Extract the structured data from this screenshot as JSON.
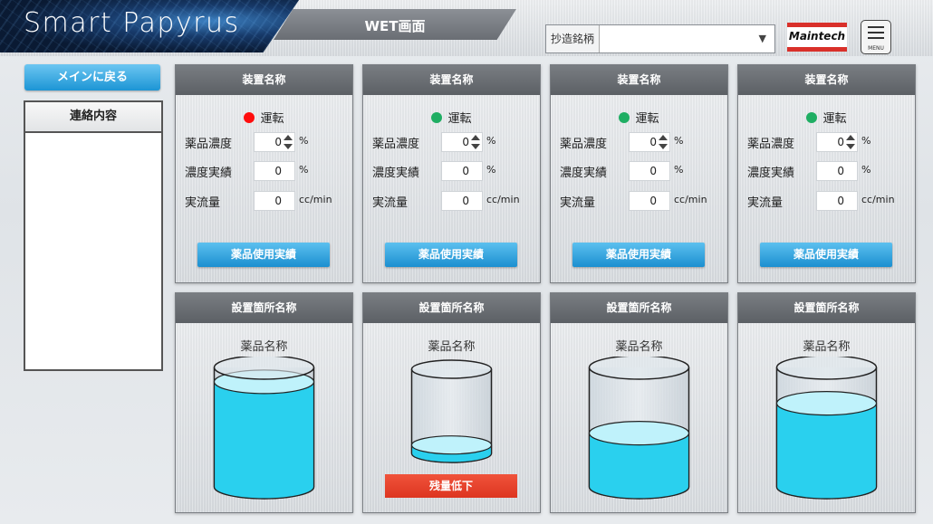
{
  "header": {
    "app_title": "Smart Papyrus",
    "screen_title": "WET画面",
    "grade_label": "抄造銘柄",
    "grade_value": "",
    "brand_logo": "Maintech",
    "menu_label": "MENU"
  },
  "sidebar": {
    "back_label": "メインに戻る",
    "contact_title": "連絡内容",
    "contact_body": ""
  },
  "devices": [
    {
      "title": "装置名称",
      "status": "運転",
      "status_color": "#ff0d0d",
      "rows": [
        {
          "label": "薬品濃度",
          "value": "0",
          "unit": "%",
          "spinner": true
        },
        {
          "label": "濃度実績",
          "value": "0",
          "unit": "%",
          "spinner": false
        },
        {
          "label": "実流量",
          "value": "0",
          "unit": "cc/min",
          "spinner": false
        }
      ],
      "button": "薬品使用実績"
    },
    {
      "title": "装置名称",
      "status": "運転",
      "status_color": "#1fae63",
      "rows": [
        {
          "label": "薬品濃度",
          "value": "0",
          "unit": "%",
          "spinner": true
        },
        {
          "label": "濃度実績",
          "value": "0",
          "unit": "%",
          "spinner": false
        },
        {
          "label": "実流量",
          "value": "0",
          "unit": "cc/min",
          "spinner": false
        }
      ],
      "button": "薬品使用実績"
    },
    {
      "title": "装置名称",
      "status": "運転",
      "status_color": "#1fae63",
      "rows": [
        {
          "label": "薬品濃度",
          "value": "0",
          "unit": "%",
          "spinner": true
        },
        {
          "label": "濃度実績",
          "value": "0",
          "unit": "%",
          "spinner": false
        },
        {
          "label": "実流量",
          "value": "0",
          "unit": "cc/min",
          "spinner": false
        }
      ],
      "button": "薬品使用実績"
    },
    {
      "title": "装置名称",
      "status": "運転",
      "status_color": "#1fae63",
      "rows": [
        {
          "label": "薬品濃度",
          "value": "0",
          "unit": "%",
          "spinner": true
        },
        {
          "label": "濃度実績",
          "value": "0",
          "unit": "%",
          "spinner": false
        },
        {
          "label": "実流量",
          "value": "0",
          "unit": "cc/min",
          "spinner": false
        }
      ],
      "button": "薬品使用実績"
    }
  ],
  "tanks": [
    {
      "title": "設置箇所名称",
      "chemical": "薬品名称",
      "level": 0.88,
      "size": "normal",
      "alarm": ""
    },
    {
      "title": "設置箇所名称",
      "chemical": "薬品名称",
      "level": 0.1,
      "size": "small",
      "alarm": "残量低下"
    },
    {
      "title": "設置箇所名称",
      "chemical": "薬品名称",
      "level": 0.45,
      "size": "normal",
      "alarm": ""
    },
    {
      "title": "設置箇所名称",
      "chemical": "薬品名称",
      "level": 0.7,
      "size": "normal",
      "alarm": ""
    }
  ],
  "colors": {
    "liquid": "#2ad0ee",
    "liquid_top": "#bff2fb",
    "button": "#1c95d5",
    "alarm": "#e03a22"
  }
}
